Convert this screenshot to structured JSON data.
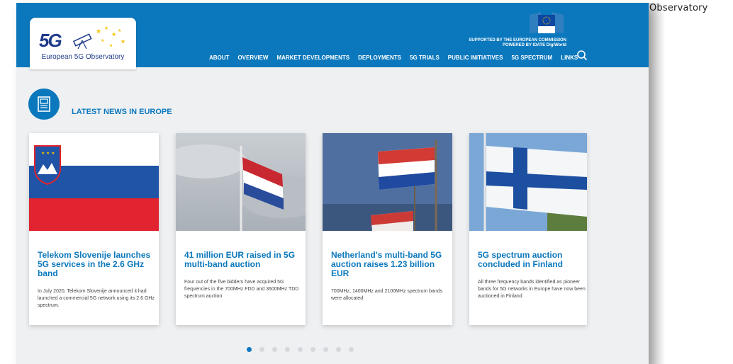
{
  "corner_label": "Observatory",
  "logo": {
    "mark": "5G",
    "text": "European 5G Observatory"
  },
  "support": {
    "line1": "SUPPORTED BY THE EUROPEAN COMMISSION",
    "line2": "POWERED BY IDATE DigiWorld"
  },
  "nav": [
    "ABOUT",
    "OVERVIEW",
    "MARKET DEVELOPMENTS",
    "DEPLOYMENTS",
    "5G TRIALS",
    "PUBLIC INITIATIVES",
    "5G SPECTRUM",
    "LINKS"
  ],
  "news": {
    "heading": "LATEST NEWS IN EUROPE"
  },
  "cards": [
    {
      "title": "Telekom Slovenije launches 5G services in the 2.6 GHz band",
      "desc": "In July 2020, Telekom Slovenije announced it had launched a commercial 5G network using its 2.6 GHz spectrum."
    },
    {
      "title": "41 million EUR raised in 5G multi-band auction",
      "desc": "Four out of the five bidders have acquired 5G frequencies in the 700MHz FDD and 3600MHz TDD spectrum auction"
    },
    {
      "title": "Netherland’s multi-band 5G auction raises 1.23 billion EUR",
      "desc": "700MHz, 1400MHz and 2100MHz spectrum bands were allocated"
    },
    {
      "title": "5G spectrum auction concluded in Finland",
      "desc": "All three frequency bands identified as pioneer bands for 5G networks in Europe have now been auctioned in Finland"
    }
  ],
  "carousel": {
    "active": 0,
    "count": 9
  },
  "colors": {
    "brand": "#0b78bd",
    "nav_text": "#ffffff",
    "dot_inactive": "#d5d9de"
  }
}
